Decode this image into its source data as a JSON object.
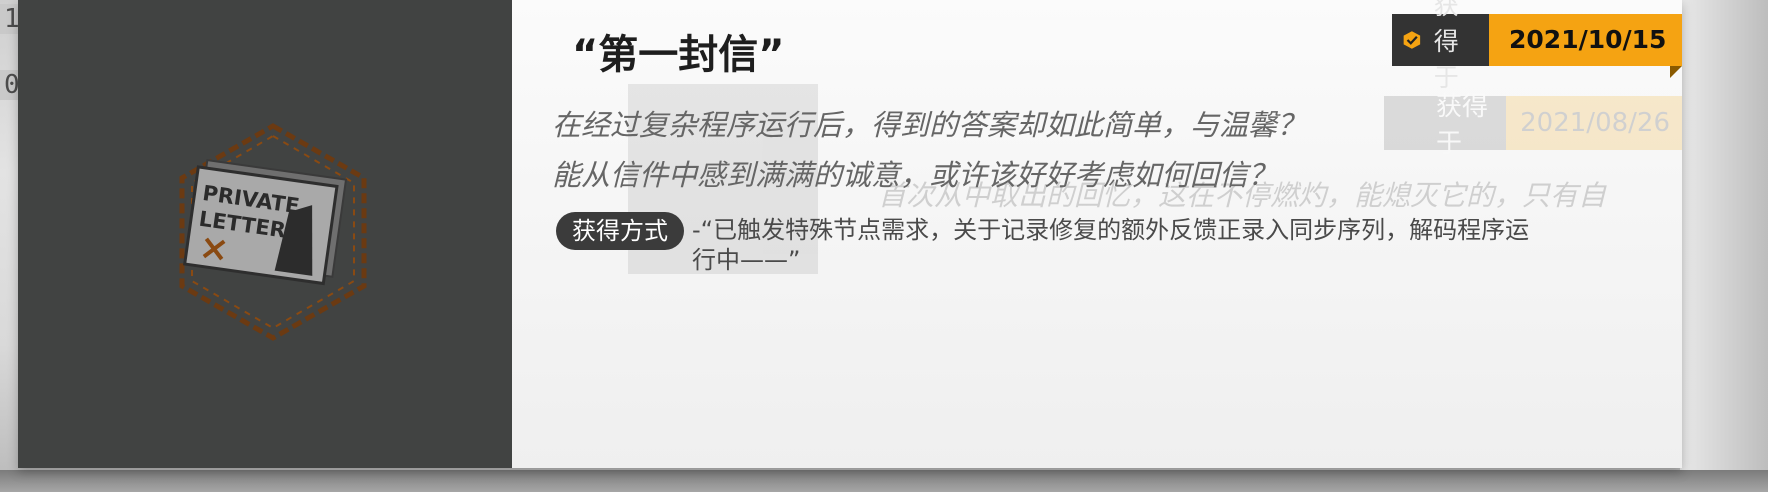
{
  "background": {
    "left_text_top": "1",
    "left_text_mid": "0"
  },
  "card": {
    "title": "“第一封信”",
    "art_caption_line1": "PRIVATE",
    "art_caption_line2": "LETTER",
    "obtained": {
      "label": "获得于",
      "date": "2021/10/15",
      "icon": "check-shield-icon",
      "accent": "#f5a312"
    },
    "description": [
      "在经过复杂程序运行后，得到的答案却如此简单，与温馨？",
      "能从信件中感到满满的诚意，或许该好好考虑如何回信？"
    ],
    "method": {
      "label": "获得方式",
      "text": "-“已触发特殊节点需求，关于记录修复的额外反馈正录入同步序列，解码程序运行中——”"
    }
  },
  "ghost_card": {
    "label": "获得于",
    "date": "2021/08/26",
    "quote": "首次从中取出的回忆，这在不停燃灼，能熄灭它的，只有自"
  }
}
